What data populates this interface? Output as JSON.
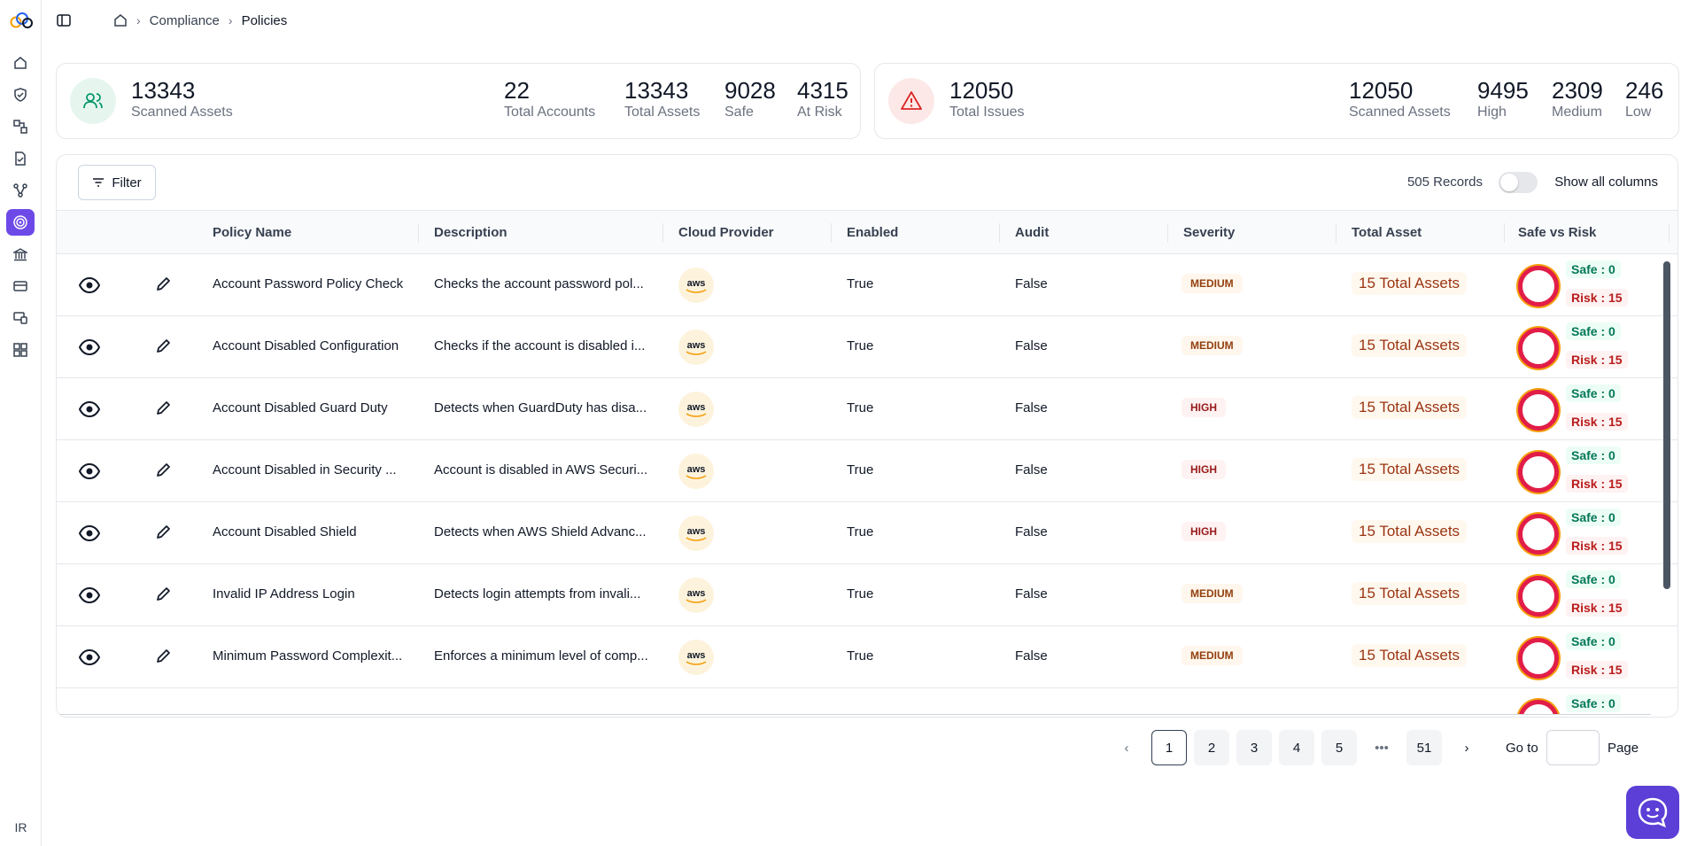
{
  "breadcrumb": {
    "items": [
      "Compliance",
      "Policies"
    ]
  },
  "assets_card": {
    "main_value": "13343",
    "main_label": "Scanned Assets",
    "stats": [
      {
        "value": "22",
        "label": "Total Accounts"
      },
      {
        "value": "13343",
        "label": "Total Assets"
      },
      {
        "value": "9028",
        "label": "Safe"
      },
      {
        "value": "4315",
        "label": "At Risk"
      }
    ]
  },
  "issues_card": {
    "main_value": "12050",
    "main_label": "Total Issues",
    "stats": [
      {
        "value": "12050",
        "label": "Scanned Assets"
      },
      {
        "value": "9495",
        "label": "High"
      },
      {
        "value": "2309",
        "label": "Medium"
      },
      {
        "value": "246",
        "label": "Low"
      }
    ]
  },
  "toolbar": {
    "filter_label": "Filter",
    "records": "505 Records",
    "show_columns_label": "Show all columns"
  },
  "columns": [
    "Policy Name",
    "Description",
    "Cloud Provider",
    "Enabled",
    "Audit",
    "Severity",
    "Total Asset",
    "Safe vs Risk"
  ],
  "rows": [
    {
      "name": "Account Password Policy Check",
      "description": "Checks the account password pol...",
      "provider": "aws",
      "enabled": "True",
      "audit": "False",
      "severity": "MEDIUM",
      "total_asset": "15 Total Assets",
      "safe": "Safe : 0",
      "risk": "Risk : 15"
    },
    {
      "name": "Account Disabled Configuration",
      "description": "Checks if the account is disabled i...",
      "provider": "aws",
      "enabled": "True",
      "audit": "False",
      "severity": "MEDIUM",
      "total_asset": "15 Total Assets",
      "safe": "Safe : 0",
      "risk": "Risk : 15"
    },
    {
      "name": "Account Disabled Guard Duty",
      "description": "Detects when GuardDuty has disa...",
      "provider": "aws",
      "enabled": "True",
      "audit": "False",
      "severity": "HIGH",
      "total_asset": "15 Total Assets",
      "safe": "Safe : 0",
      "risk": "Risk : 15"
    },
    {
      "name": "Account Disabled in Security ...",
      "description": "Account is disabled in AWS Securi...",
      "provider": "aws",
      "enabled": "True",
      "audit": "False",
      "severity": "HIGH",
      "total_asset": "15 Total Assets",
      "safe": "Safe : 0",
      "risk": "Risk : 15"
    },
    {
      "name": "Account Disabled Shield",
      "description": "Detects when AWS Shield Advanc...",
      "provider": "aws",
      "enabled": "True",
      "audit": "False",
      "severity": "HIGH",
      "total_asset": "15 Total Assets",
      "safe": "Safe : 0",
      "risk": "Risk : 15"
    },
    {
      "name": "Invalid IP Address Login",
      "description": "Detects login attempts from invali...",
      "provider": "aws",
      "enabled": "True",
      "audit": "False",
      "severity": "MEDIUM",
      "total_asset": "15 Total Assets",
      "safe": "Safe : 0",
      "risk": "Risk : 15"
    },
    {
      "name": "Minimum Password Complexit...",
      "description": "Enforces a minimum level of comp...",
      "provider": "aws",
      "enabled": "True",
      "audit": "False",
      "severity": "MEDIUM",
      "total_asset": "15 Total Assets",
      "safe": "Safe : 0",
      "risk": "Risk : 15"
    }
  ],
  "partial_row": {
    "safe": "Safe : 0"
  },
  "pagination": {
    "pages": [
      "1",
      "2",
      "3",
      "4",
      "5"
    ],
    "ellipsis": "•••",
    "last": "51",
    "goto_label": "Go to",
    "page_label": "Page"
  },
  "user_initials": "IR",
  "colors": {
    "accent": "#6d4ae8",
    "risk": "#e11d48",
    "safe": "#047857"
  }
}
